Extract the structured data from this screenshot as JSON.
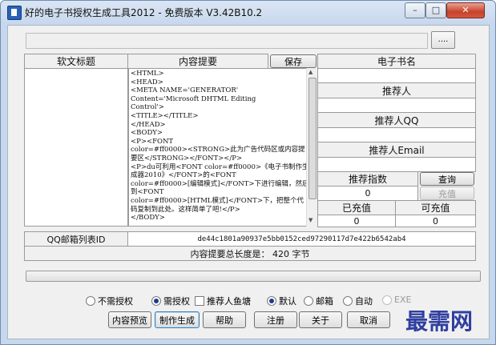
{
  "window": {
    "title": "好的电子书授权生成工具2012 - 免费版本 V3.42B10.2",
    "btn_min": "–",
    "btn_max": "□",
    "btn_close": "✕"
  },
  "toolbar": {
    "path_value": "",
    "browse_label": "...."
  },
  "table": {
    "col_title": "软文标题",
    "col_summary": "内容提要",
    "save_label": "保存",
    "col_ebook": "电子书名",
    "content_text": "<HTML>\n<HEAD>\n<META NAME='GENERATOR'\nContent='Microsoft DHTML Editing\nControl'>\n<TITLE></TITLE>\n</HEAD>\n<BODY>\n<P><FONT\ncolor=#ff0000><STRONG>此为广告代码区或内容提要区</STRONG></FONT></P>\n<P>du可利用<FONT color=#ff0000>《电子书制作生成器2010》</FONT>的<FONT\ncolor=#ff0000>[编辑模式]</FONT>下进行编辑，然后到<FONT\ncolor=#ff0000>[HTML模式]</FONT>下，把整个代码复制到此处。这样简单了吧!</P>\n</BODY>",
    "recommender": "推荐人",
    "recommender_qq": "推荐人QQ",
    "recommender_email": "推荐人Email",
    "rec_index": "推荐指数",
    "query": "查询",
    "rec_index_value": "0",
    "recharge": "充值",
    "charged": "已充值",
    "rechargeable": "可充值",
    "charged_value": "0",
    "rechargeable_value": "0",
    "qq_mail_label": "QQ邮箱列表ID",
    "qq_mail_value": "de44c1801a90937e5bb0152ced97290117d7e422b6542ab4",
    "summary_length_text": "内容提要总长度是：  420  字节"
  },
  "options": {
    "no_auth": "不需授权",
    "need_auth": "需授权",
    "rec_fish": "推荐人鱼塘",
    "default": "默认",
    "email": "邮箱",
    "auto": "自动",
    "exe": "EXE"
  },
  "buttons": {
    "preview": "内容预览",
    "generate": "制作生成",
    "help": "帮助",
    "register": "注册",
    "about": "关于",
    "cancel": "取消"
  },
  "watermark": "最需网"
}
